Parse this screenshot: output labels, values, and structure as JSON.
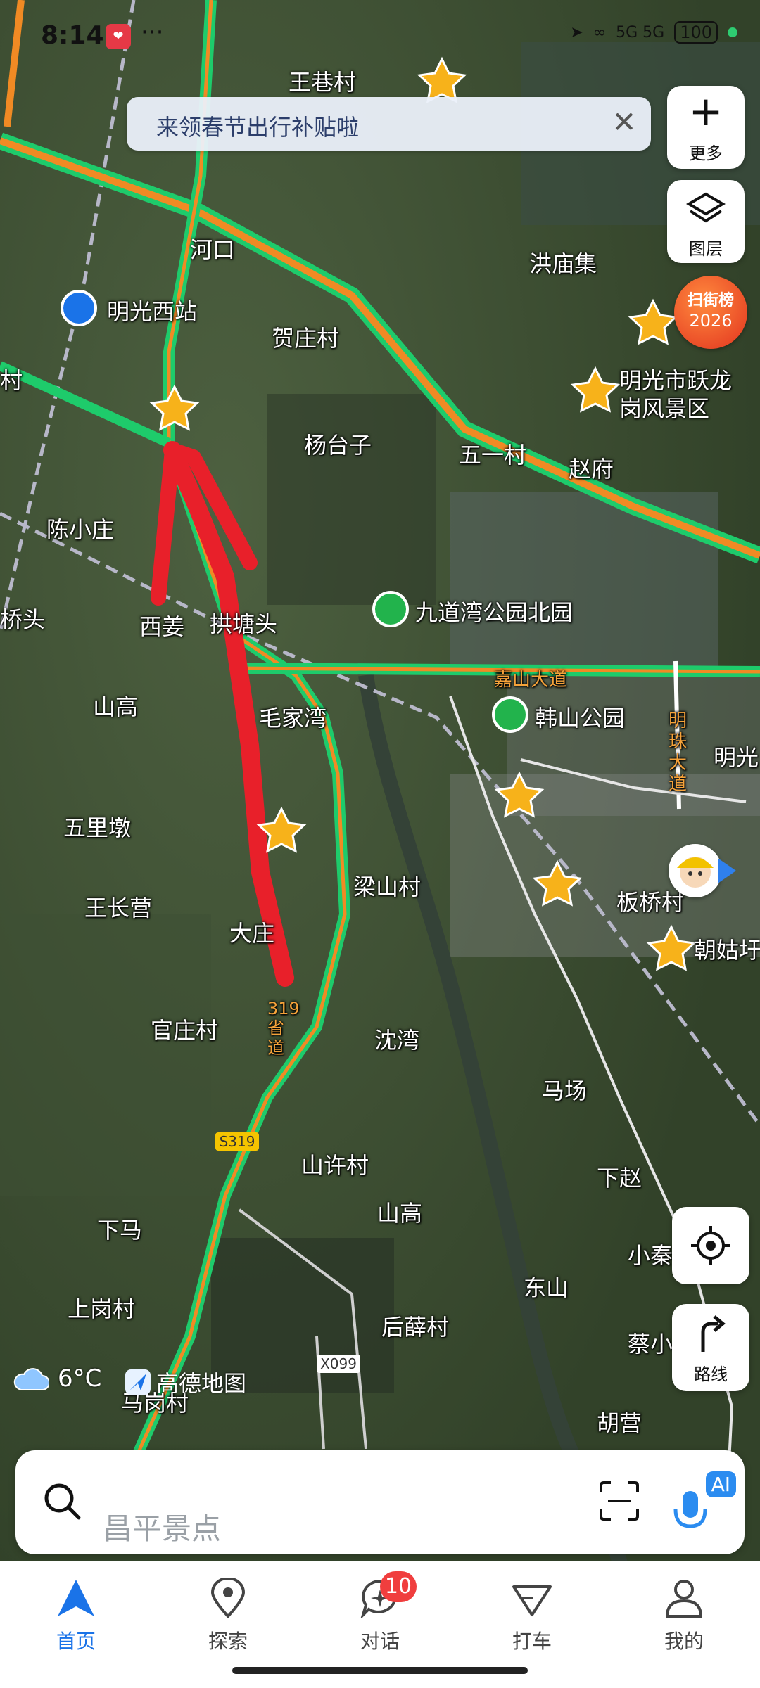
{
  "status_bar": {
    "time": "8:14",
    "dots": "···",
    "network": "5G 5G",
    "battery": "100"
  },
  "banner": {
    "text": "来领春节出行补贴啦"
  },
  "side_buttons": {
    "more_label": "更多",
    "layers_label": "图层",
    "locate_icon": "crosshair-icon",
    "route_label": "路线"
  },
  "rank_badge": {
    "line1": "扫街榜",
    "line2": "2026"
  },
  "map_labels": {
    "wangxiang": "王巷村",
    "hekou": "河口",
    "hongmiaoji": "洪庙集",
    "station": "明光西站",
    "hezhuang": "贺庄村",
    "cun_left": "村",
    "yuelong1": "明光市跃龙",
    "yuelong2": "岗风景区",
    "yangtaizi": "杨台子",
    "wuyi": "五一村",
    "zhaofu": "赵府",
    "chenxiaozhuang": "陈小庄",
    "qiaotou": "桥头",
    "xijiang": "西姜",
    "gongtangtou": "拱塘头",
    "jiudaowan": "九道湾公园北园",
    "jiashan_road": "嘉山大道",
    "shangao_left": "山高",
    "maojiawan": "毛家湾",
    "hanshan": "韩山公园",
    "mingzhu_road": "明珠大道",
    "mingguang_edge": "明光",
    "wulidun": "五里墩",
    "liangshan": "梁山村",
    "banqiao": "板桥村",
    "wangchangying": "王长营",
    "dazhuang": "大庄",
    "chaoguk": "朝姑圩",
    "guanzhuang": "官庄村",
    "shenwan": "沈湾",
    "road_319": "319省道",
    "machang": "马场",
    "s319": "S319",
    "shanxu": "山许村",
    "xiazhao": "下赵",
    "xiama": "下马",
    "shangao_mid": "山高",
    "xiaoqin": "小秦",
    "dongshan": "东山",
    "shanggang": "上岗村",
    "houxue": "后薛村",
    "caixiao": "蔡小",
    "x099": "X099",
    "magang": "马岗村",
    "huying": "胡营"
  },
  "weather": {
    "temp": "6°C"
  },
  "amap": {
    "name": "高德地图"
  },
  "search": {
    "placeholder": "昌平景点",
    "ai_label": "AI"
  },
  "tabs": [
    {
      "label": "首页",
      "active": true
    },
    {
      "label": "探索"
    },
    {
      "label": "对话",
      "badge": "10"
    },
    {
      "label": "打车"
    },
    {
      "label": "我的"
    }
  ],
  "colors": {
    "accent": "#1a73e8",
    "road_green": "#2ecc71",
    "road_orange": "#f08a24",
    "annotation_red": "#e8202a",
    "poi_star": "#f7b21a"
  }
}
